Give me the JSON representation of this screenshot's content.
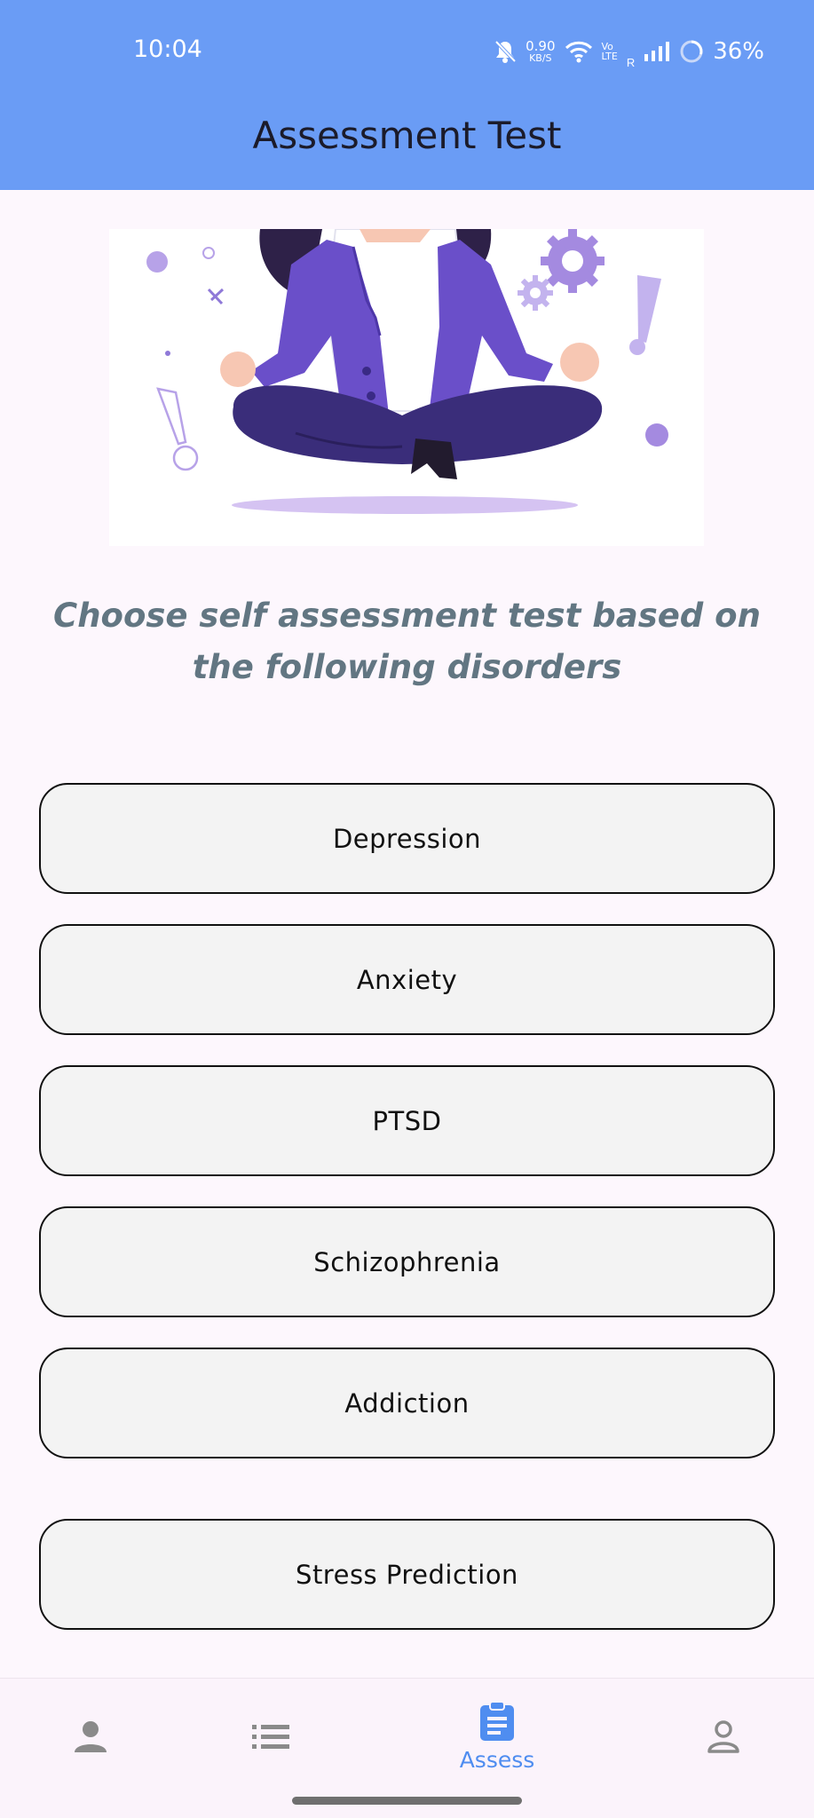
{
  "status_bar": {
    "time": "10:04",
    "speed_value": "0.90",
    "speed_unit": "KB/S",
    "network_top": "Vo",
    "network_bottom": "LTE",
    "roaming": "R",
    "battery": "36%"
  },
  "app_bar": {
    "title": "Assessment Test"
  },
  "prompt": "Choose self assessment test based on the following disorders",
  "tests": [
    {
      "label": "Depression"
    },
    {
      "label": "Anxiety"
    },
    {
      "label": "PTSD"
    },
    {
      "label": "Schizophrenia"
    },
    {
      "label": "Addiction"
    }
  ],
  "stress_button": {
    "label": "Stress Prediction"
  },
  "bottom_nav": {
    "items": [
      {
        "icon": "person-icon",
        "label": ""
      },
      {
        "icon": "list-icon",
        "label": ""
      },
      {
        "icon": "clipboard-icon",
        "label": "Assess",
        "active": true
      },
      {
        "icon": "account-icon",
        "label": ""
      }
    ],
    "active_color": "#4f8df0",
    "inactive_color": "#8a8a8a"
  },
  "colors": {
    "app_bar": "#6a9cf5",
    "background": "#fdf7fd",
    "prompt_text": "#627682",
    "button_fill": "#f3f3f3"
  }
}
